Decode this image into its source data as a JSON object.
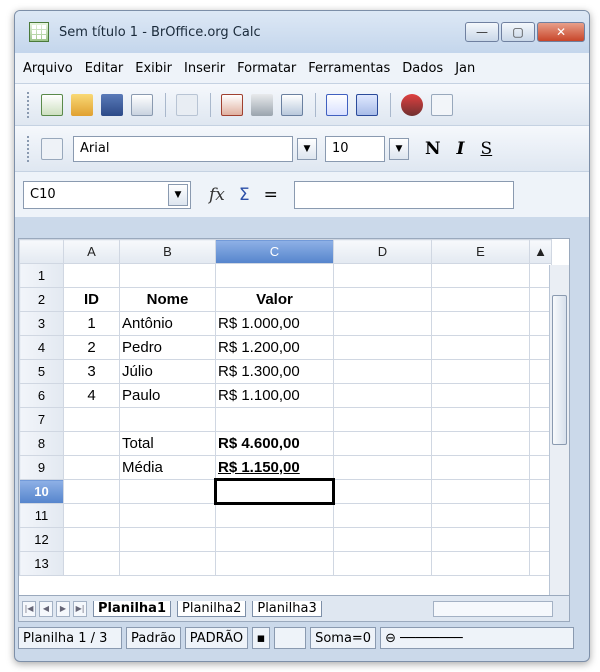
{
  "window": {
    "title": "Sem título 1 - BrOffice.org Calc",
    "min_symbol": "—",
    "max_symbol": "▢",
    "close_symbol": "✕"
  },
  "menu": [
    "Arquivo",
    "Editar",
    "Exibir",
    "Inserir",
    "Formatar",
    "Ferramentas",
    "Dados",
    "Jan"
  ],
  "fontbar": {
    "font_name": "Arial",
    "font_size": "10",
    "bold": "N",
    "italic": "I",
    "underline": "S"
  },
  "namebar": {
    "cell_ref": "C10",
    "fx": "fx",
    "sigma": "Σ",
    "equals": "="
  },
  "grid": {
    "columns": [
      "A",
      "B",
      "C",
      "D",
      "E"
    ],
    "rows": [
      {
        "num": "1",
        "a": "",
        "b": "",
        "c": ""
      },
      {
        "num": "2",
        "a": "ID",
        "b": "Nome",
        "c": "Valor"
      },
      {
        "num": "3",
        "a": "1",
        "b": "Antônio",
        "c": "R$ 1.000,00"
      },
      {
        "num": "4",
        "a": "2",
        "b": "Pedro",
        "c": "R$ 1.200,00"
      },
      {
        "num": "5",
        "a": "3",
        "b": "Júlio",
        "c": "R$ 1.300,00"
      },
      {
        "num": "6",
        "a": "4",
        "b": "Paulo",
        "c": "R$ 1.100,00"
      },
      {
        "num": "7",
        "a": "",
        "b": "",
        "c": ""
      },
      {
        "num": "8",
        "a": "",
        "b": "Total",
        "c": "R$ 4.600,00"
      },
      {
        "num": "9",
        "a": "",
        "b": "Média",
        "c": "R$ 1.150,00"
      },
      {
        "num": "10",
        "a": "",
        "b": "",
        "c": ""
      },
      {
        "num": "11",
        "a": "",
        "b": "",
        "c": ""
      },
      {
        "num": "12",
        "a": "",
        "b": "",
        "c": ""
      },
      {
        "num": "13",
        "a": "",
        "b": "",
        "c": ""
      }
    ]
  },
  "tabs": [
    "Planilha1",
    "Planilha2",
    "Planilha3"
  ],
  "status": {
    "sheet": "Planilha 1 / 3",
    "style": "Padrão",
    "mode": "PADRÃO",
    "sum": "Soma=0"
  }
}
